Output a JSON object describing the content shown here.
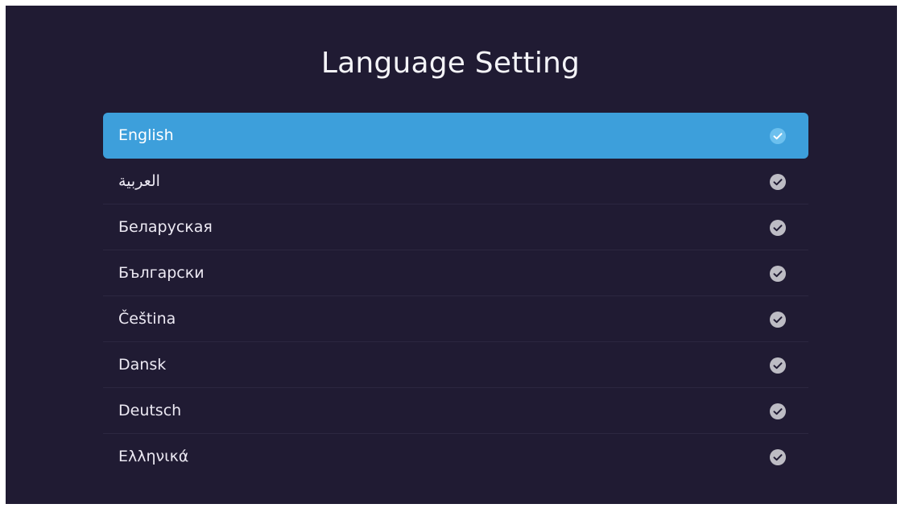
{
  "page": {
    "title": "Language Setting"
  },
  "languages": [
    {
      "label": "English",
      "selected": true
    },
    {
      "label": "العربية",
      "selected": false
    },
    {
      "label": "Беларуская",
      "selected": false
    },
    {
      "label": "Български",
      "selected": false
    },
    {
      "label": "Čeština",
      "selected": false
    },
    {
      "label": "Dansk",
      "selected": false
    },
    {
      "label": "Deutsch",
      "selected": false
    },
    {
      "label": "Ελληνικά",
      "selected": false
    }
  ],
  "icons": {
    "check": "check-circle-icon"
  },
  "colors": {
    "background": "#201b33",
    "selected_row": "#3d9fdb",
    "check_default": "#bdbcc4",
    "check_selected": "#6cc0ee"
  }
}
